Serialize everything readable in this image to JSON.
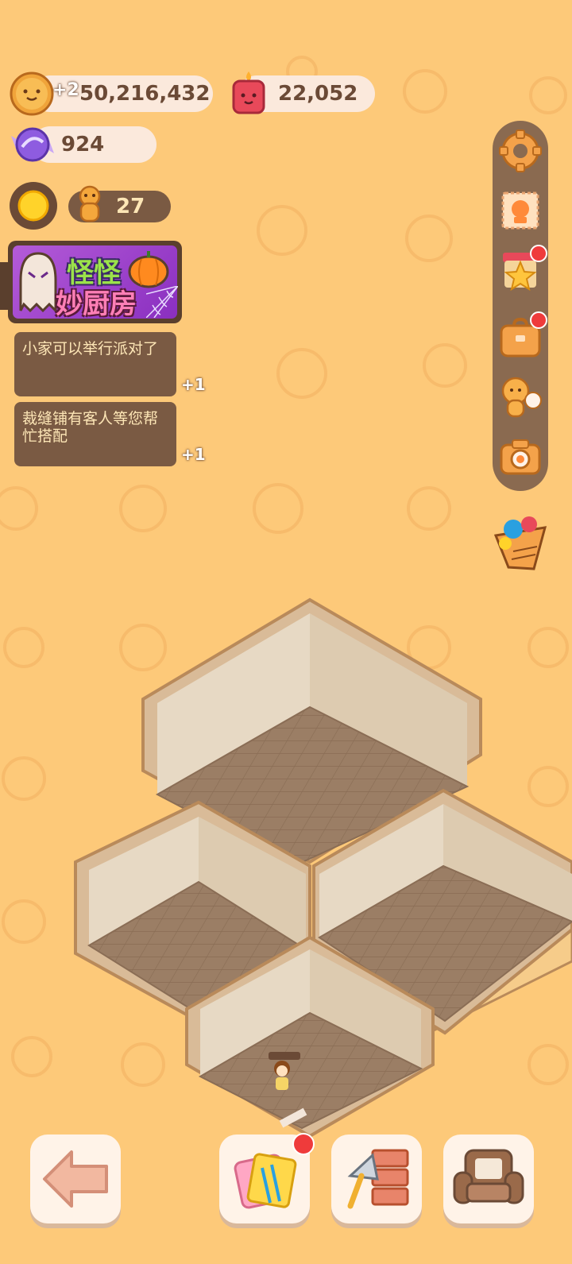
{
  "resources": {
    "cookies": {
      "value": "50,216,432",
      "bonus": "+2",
      "icon": "cookie-face-icon"
    },
    "candle": {
      "value": "22,052",
      "icon": "red-candle-icon"
    },
    "candy": {
      "value": "924",
      "icon": "purple-candy-icon"
    },
    "gingerbread": {
      "value": "27",
      "icon": "gingerbread-icon"
    }
  },
  "event_banner": {
    "title_line1": "怪怪",
    "title_line2": "妙厨房"
  },
  "quests": [
    {
      "text": "小家可以举行派对了",
      "reward": "+1"
    },
    {
      "text": "裁缝铺有客人等您帮忙搭配",
      "reward": "+1"
    }
  ],
  "side_menu": [
    {
      "name": "settings",
      "icon": "gear-icon",
      "badge": false
    },
    {
      "name": "stamp",
      "icon": "stamp-icon",
      "badge": false
    },
    {
      "name": "shop",
      "icon": "star-shop-icon",
      "badge": true
    },
    {
      "name": "bag",
      "icon": "bag-icon",
      "badge": true
    },
    {
      "name": "friends",
      "icon": "friends-icon",
      "badge": false
    },
    {
      "name": "camera",
      "icon": "camera-icon",
      "badge": false
    }
  ],
  "bottom_bar": [
    {
      "name": "back",
      "icon": "arrow-left-icon",
      "badge": false
    },
    {
      "name": "wallpaper",
      "icon": "wallpaper-icon",
      "badge": true
    },
    {
      "name": "build",
      "icon": "trowel-brick-icon",
      "badge": false
    },
    {
      "name": "furniture",
      "icon": "sofa-icon",
      "badge": false
    }
  ],
  "colors": {
    "background": "#fdc979",
    "pill": "#fbe9dc",
    "quest_panel": "#7a5a43",
    "quest_text": "#fde6b6",
    "badge": "#ef3b3b",
    "banner_purple": "#9c3fc9"
  }
}
